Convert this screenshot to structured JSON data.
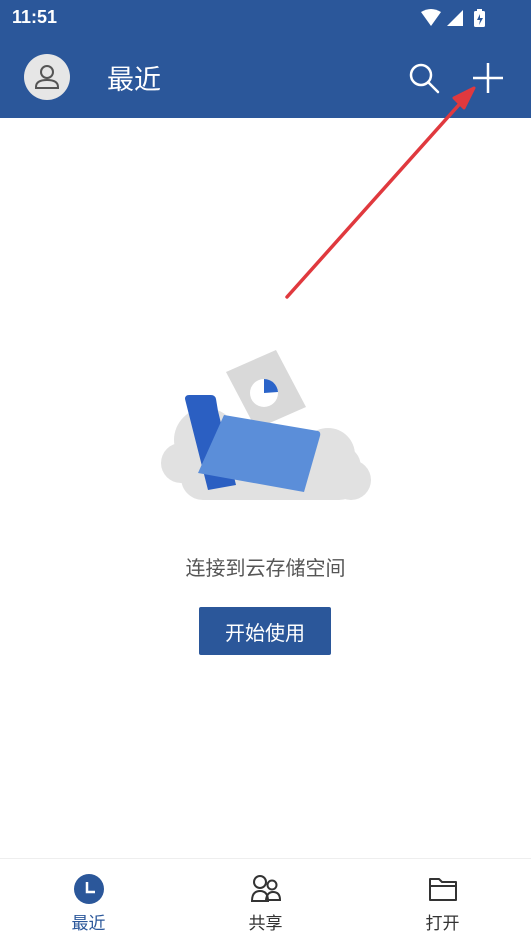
{
  "status_bar": {
    "time": "11:51",
    "icons": [
      "wifi-icon",
      "signal-icon",
      "battery-charging-icon"
    ]
  },
  "app_bar": {
    "title": "最近",
    "avatar_icon": "user-avatar-icon",
    "actions": [
      "search-icon",
      "add-icon"
    ]
  },
  "annotation": {
    "type": "arrow",
    "color": "#e0393e",
    "target": "add-button"
  },
  "empty_state": {
    "illustration": "folder-cloud-illustration",
    "message": "连接到云存储空间",
    "button_label": "开始使用"
  },
  "bottom_nav": {
    "items": [
      {
        "label": "最近",
        "icon": "clock-icon",
        "active": true
      },
      {
        "label": "共享",
        "icon": "people-icon",
        "active": false
      },
      {
        "label": "打开",
        "icon": "folder-icon",
        "active": false
      }
    ]
  },
  "colors": {
    "primary": "#2b579a",
    "annotation_arrow": "#e0393e",
    "text_secondary": "#555555"
  }
}
